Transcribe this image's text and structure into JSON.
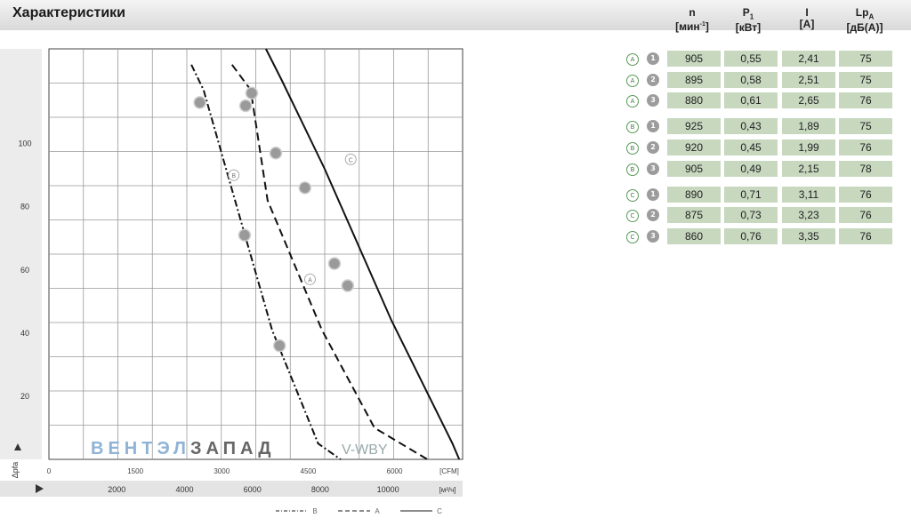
{
  "header": {
    "title": "Характеристики"
  },
  "table": {
    "columns": [
      {
        "name": "n",
        "unit": "[мин",
        "unit_sup": "-1",
        "unit_end": "]"
      },
      {
        "name": "P",
        "sub": "1",
        "unit": "[кВт]"
      },
      {
        "name": "I",
        "unit": "[A]"
      },
      {
        "name": "Lp",
        "sub": "A",
        "unit": "[дБ(A)]"
      }
    ],
    "rows": [
      {
        "group": "A",
        "index": "1",
        "n": "905",
        "p1": "0,55",
        "i": "2,41",
        "lpa": "75"
      },
      {
        "group": "A",
        "index": "2",
        "n": "895",
        "p1": "0,58",
        "i": "2,51",
        "lpa": "75"
      },
      {
        "group": "A",
        "index": "3",
        "n": "880",
        "p1": "0,61",
        "i": "2,65",
        "lpa": "76"
      },
      {
        "group": "B",
        "index": "1",
        "n": "925",
        "p1": "0,43",
        "i": "1,89",
        "lpa": "75"
      },
      {
        "group": "B",
        "index": "2",
        "n": "920",
        "p1": "0,45",
        "i": "1,99",
        "lpa": "76"
      },
      {
        "group": "B",
        "index": "3",
        "n": "905",
        "p1": "0,49",
        "i": "2,15",
        "lpa": "78"
      },
      {
        "group": "C",
        "index": "1",
        "n": "890",
        "p1": "0,71",
        "i": "3,11",
        "lpa": "76"
      },
      {
        "group": "C",
        "index": "2",
        "n": "875",
        "p1": "0,73",
        "i": "3,23",
        "lpa": "76"
      },
      {
        "group": "C",
        "index": "3",
        "n": "860",
        "p1": "0,76",
        "i": "3,35",
        "lpa": "76"
      }
    ]
  },
  "chart_data": {
    "type": "line",
    "y_axis": {
      "label": "Δpfa",
      "ticks": [
        "20",
        "40",
        "60",
        "80",
        "100"
      ],
      "ylim": [
        0,
        130
      ]
    },
    "x_axis_cfm": {
      "unit": "[CFM]",
      "ticks": [
        "0",
        "1500",
        "3000",
        "4500",
        "6000"
      ]
    },
    "x_axis_m3h": {
      "unit": "[м³/ч]",
      "ticks": [
        "2000",
        "4000",
        "6000",
        "8000",
        "10000"
      ],
      "xlim": [
        0,
        12200
      ]
    },
    "series": [
      {
        "name": "B",
        "style": "dash-dot",
        "x": [
          4200,
          4560,
          5700,
          6580,
          7940,
          8600
        ],
        "y": [
          125,
          117,
          74,
          41,
          5,
          0
        ]
      },
      {
        "name": "A",
        "style": "dashed",
        "x": [
          5400,
          5950,
          6450,
          8050,
          9600,
          11160
        ],
        "y": [
          125,
          117,
          82,
          41,
          10,
          0
        ]
      },
      {
        "name": "C",
        "style": "solid",
        "x": [
          6400,
          6870,
          8130,
          10100,
          11900,
          12100
        ],
        "y": [
          130,
          120,
          92,
          44,
          5,
          0
        ]
      }
    ],
    "points": [
      {
        "series": "A",
        "x": 5800,
        "y": 112
      },
      {
        "series": "A",
        "x": 7550,
        "y": 86
      },
      {
        "series": "A",
        "x": 8810,
        "y": 55
      },
      {
        "series": "B",
        "x": 4450,
        "y": 113
      },
      {
        "series": "B",
        "x": 5770,
        "y": 71
      },
      {
        "series": "B",
        "x": 6800,
        "y": 36
      },
      {
        "series": "C",
        "x": 5980,
        "y": 116
      },
      {
        "series": "C",
        "x": 6690,
        "y": 97
      },
      {
        "series": "C",
        "x": 8420,
        "y": 62
      }
    ],
    "curve_labels": [
      {
        "text": "B",
        "x": 5450,
        "y": 90
      },
      {
        "text": "A",
        "x": 7700,
        "y": 57
      },
      {
        "text": "C",
        "x": 8900,
        "y": 95
      }
    ],
    "legend": [
      {
        "name": "B",
        "style": "dash-dot"
      },
      {
        "name": "A",
        "style": "dashed"
      },
      {
        "name": "C",
        "style": "solid"
      }
    ],
    "watermark": {
      "part1": "ВЕНТЭЛ",
      "part2": "ЗАПАД",
      "part3": "V-WBY"
    }
  }
}
